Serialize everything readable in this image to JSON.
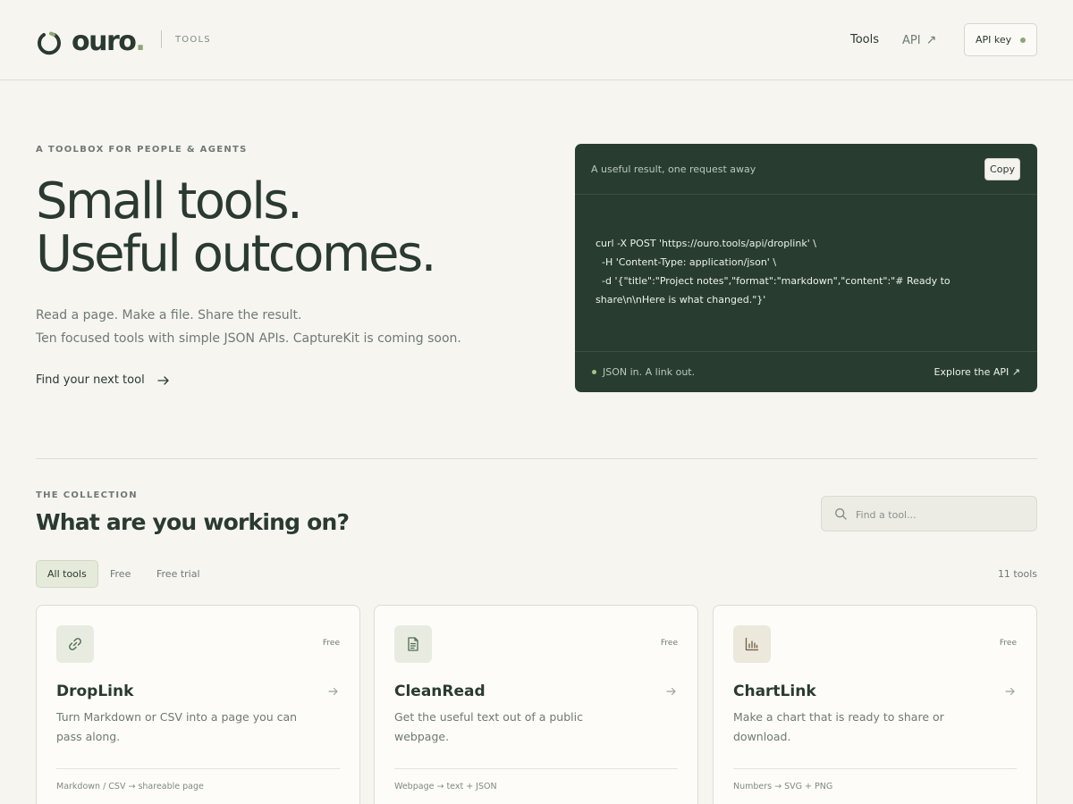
{
  "header": {
    "logo_word": "ouro",
    "logo_dot": ".",
    "logo_sub": "TOOLS",
    "nav_tools": "Tools",
    "nav_api": "API",
    "nav_api_arrow": "↗",
    "api_key_label": "API key"
  },
  "hero": {
    "eyebrow": "A TOOLBOX FOR PEOPLE & AGENTS",
    "title_line1": "Small tools.",
    "title_line2": "Useful outcomes.",
    "desc_line1": "Read a page. Make a file. Share the result.",
    "desc_line2": "Ten focused tools with simple JSON APIs. CaptureKit is coming soon.",
    "cta": "Find your next tool"
  },
  "code_panel": {
    "title": "A useful result, one request away",
    "copy_label": "Copy",
    "lines": [
      "curl -X POST 'https://ouro.tools/api/droplink' \\",
      "  -H 'Content-Type: application/json' \\",
      "  -d '{\"title\":\"Project notes\",\"format\":\"markdown\",\"content\":\"# Ready to share\\n\\nHere is what changed.\"}'"
    ],
    "footer_left": "JSON in. A link out.",
    "footer_right": "Explore the API ↗"
  },
  "collection": {
    "eyebrow": "THE COLLECTION",
    "title": "What are you working on?",
    "search_placeholder": "Find a tool...",
    "filters": [
      "All tools",
      "Free",
      "Free trial"
    ],
    "active_filter": "All tools",
    "count": "11 tools",
    "cards": [
      {
        "name": "DropLink",
        "icon": "link-icon",
        "badge": "Free",
        "description": "Turn Markdown or CSV into a page you can pass along.",
        "meta": "Markdown / CSV → shareable page"
      },
      {
        "name": "CleanRead",
        "icon": "document-icon",
        "badge": "Free",
        "description": "Get the useful text out of a public webpage.",
        "meta": "Webpage → text + JSON"
      },
      {
        "name": "ChartLink",
        "icon": "bar-chart-icon",
        "badge": "Free",
        "description": "Make a chart that is ready to share or download.",
        "meta": "Numbers → SVG + PNG"
      }
    ]
  },
  "colors": {
    "background": "#f6f5f0",
    "ink": "#2a3a30",
    "accent": "#8fa577",
    "panel": "#283d30"
  }
}
